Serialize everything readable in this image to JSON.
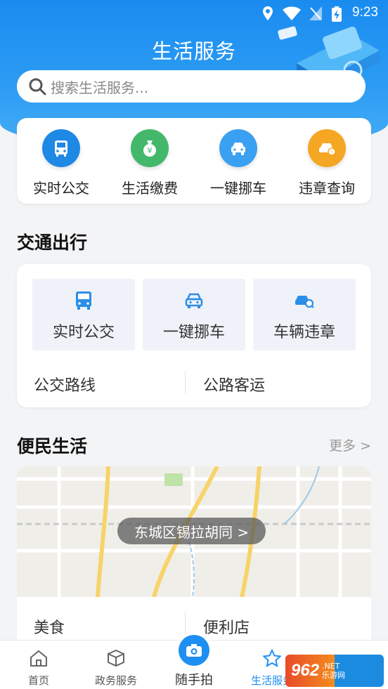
{
  "status_bar": {
    "time": "9:23"
  },
  "header": {
    "title": "生活服务",
    "search_placeholder": "搜索生活服务..."
  },
  "quick_actions": [
    {
      "label": "实时公交",
      "icon": "bus-icon",
      "color": "#1e88e5"
    },
    {
      "label": "生活缴费",
      "icon": "money-bag-icon",
      "color": "#43b86a"
    },
    {
      "label": "一键挪车",
      "icon": "car-icon",
      "color": "#3aa0f2"
    },
    {
      "label": "违章查询",
      "icon": "car-violation-icon",
      "color": "#f5a623"
    }
  ],
  "traffic": {
    "title": "交通出行",
    "boxes": [
      {
        "label": "实时公交",
        "icon": "bus-icon"
      },
      {
        "label": "一键挪车",
        "icon": "car-front-icon"
      },
      {
        "label": "车辆违章",
        "icon": "car-search-icon"
      }
    ],
    "links": [
      "公交路线",
      "公路客运"
    ]
  },
  "life": {
    "title": "便民生活",
    "more": "更多 >",
    "location": "东城区锡拉胡同 >",
    "links": [
      "美食",
      "便利店"
    ]
  },
  "bottom_nav": {
    "items": [
      "首页",
      "政务服务",
      "随手拍",
      "生活服务"
    ],
    "active": "生活服务"
  },
  "watermark": {
    "text_big": "962",
    "text_small_top": ".NET",
    "text_small_bottom": "乐游网"
  },
  "colors": {
    "primary": "#1a8cf0",
    "active_nav": "#1e8ff2"
  }
}
